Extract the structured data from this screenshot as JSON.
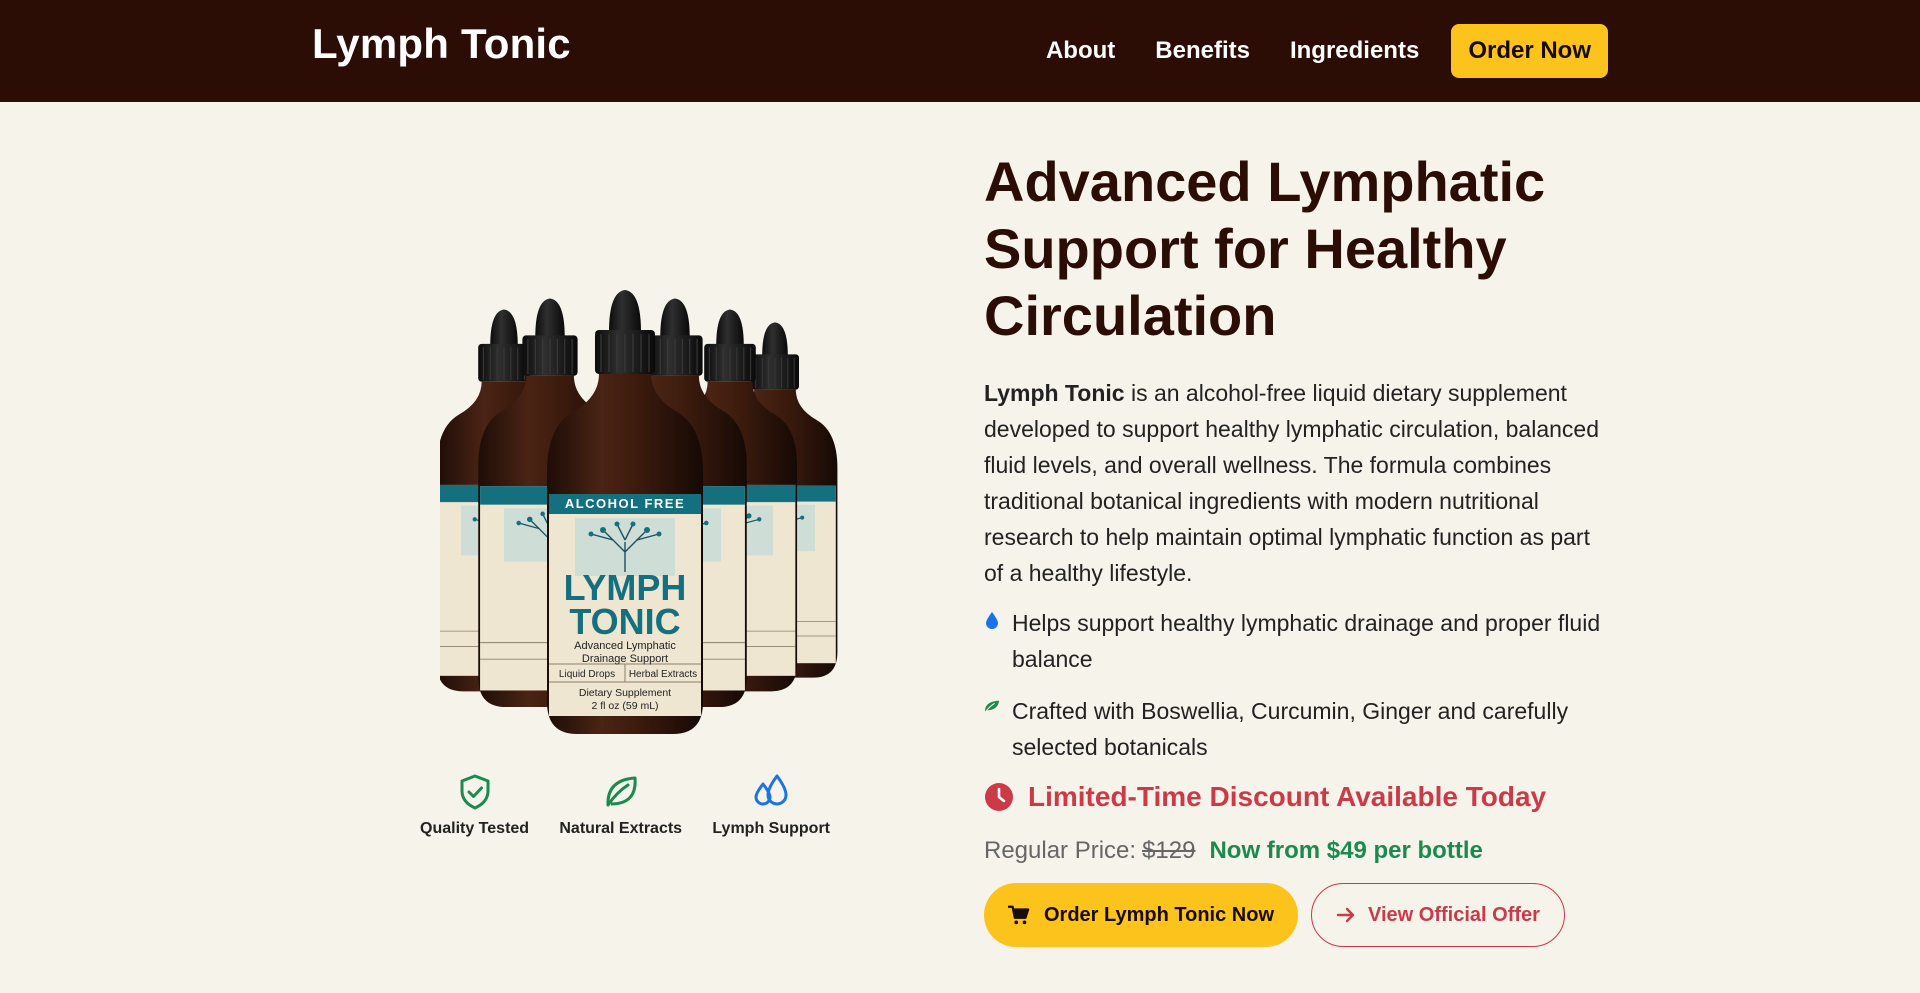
{
  "header": {
    "brand": "Lymph Tonic",
    "nav": [
      "About",
      "Benefits",
      "Ingredients"
    ],
    "order_button": "Order Now"
  },
  "product": {
    "bottle_label": {
      "top_band": "ALCOHOL FREE",
      "name_line1": "LYMPH",
      "name_line2": "TONIC",
      "subtitle_line1": "Advanced Lymphatic",
      "subtitle_line2": "Drainage Support",
      "left_box": "Liquid Drops",
      "right_box": "Herbal Extracts",
      "footer_line1": "Dietary Supplement",
      "footer_line2": "2 fl oz (59 mL)"
    },
    "badges": [
      {
        "label": "Quality Tested",
        "icon": "shield-check-icon"
      },
      {
        "label": "Natural Extracts",
        "icon": "leaf-icon"
      },
      {
        "label": "Lymph Support",
        "icon": "droplets-icon"
      }
    ]
  },
  "hero": {
    "headline": "Advanced Lymphatic Support for Healthy Circulation",
    "intro_brand": "Lymph Tonic",
    "intro_text": " is an alcohol-free liquid dietary supplement developed to support healthy lymphatic circulation, balanced fluid levels, and overall wellness. The formula combines traditional botanical ingredients with modern nutritional research to help maintain optimal lymphatic function as part of a healthy lifestyle.",
    "bullets": [
      {
        "text": "Helps support healthy lymphatic drainage and proper fluid balance",
        "icon": "droplet-icon"
      },
      {
        "text": "Crafted with Boswellia, Curcumin, Ginger and carefully selected botanicals",
        "icon": "leaf-icon"
      }
    ],
    "discount": "Limited-Time Discount Available Today",
    "regular_label": "Regular Price:",
    "regular_price": "$129",
    "now_price": "Now from $49 per bottle",
    "cta_primary": "Order Lymph Tonic Now",
    "cta_secondary": "View Official Offer"
  },
  "colors": {
    "header_bg": "#2b0d06",
    "accent_yellow": "#fcc31c",
    "discount_red": "#cc3a48",
    "price_green": "#1b8a4e",
    "page_bg": "#f6f3ea"
  }
}
